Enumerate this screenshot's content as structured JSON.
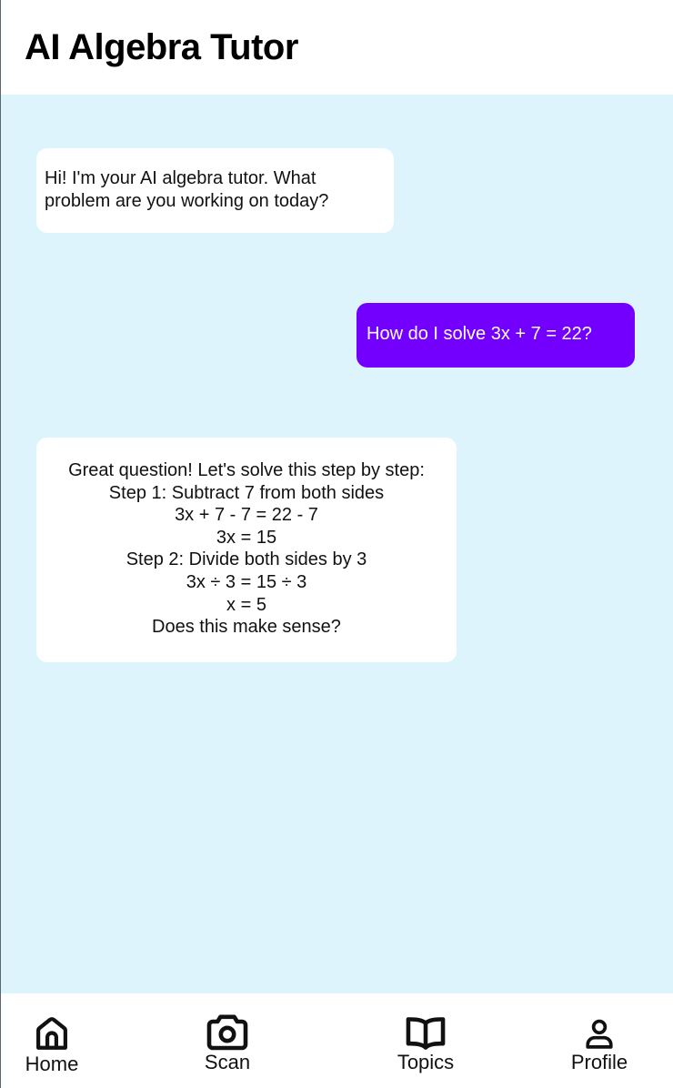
{
  "header": {
    "title": "AI Algebra Tutor"
  },
  "chat": {
    "messages": [
      {
        "sender": "tutor",
        "text": "Hi! I'm your AI algebra tutor. What problem are you working on today?"
      },
      {
        "sender": "user",
        "text": "How do I solve 3x + 7 = 22?"
      },
      {
        "sender": "tutor",
        "text": "Great question! Let's solve this step by step:\nStep 1: Subtract 7 from both sides\n3x + 7 - 7 = 22 - 7\n3x = 15\nStep 2: Divide both sides by 3\n3x ÷ 3 = 15 ÷ 3\nx = 5\nDoes this make sense?"
      }
    ]
  },
  "nav": {
    "items": [
      {
        "label": "Home",
        "icon": "home-icon"
      },
      {
        "label": "Scan",
        "icon": "camera-icon"
      },
      {
        "label": "Topics",
        "icon": "book-icon"
      },
      {
        "label": "Profile",
        "icon": "user-icon"
      }
    ]
  },
  "colors": {
    "chat_background": "#ddf4fd",
    "user_bubble": "#7300ff",
    "tutor_bubble": "#ffffff"
  }
}
